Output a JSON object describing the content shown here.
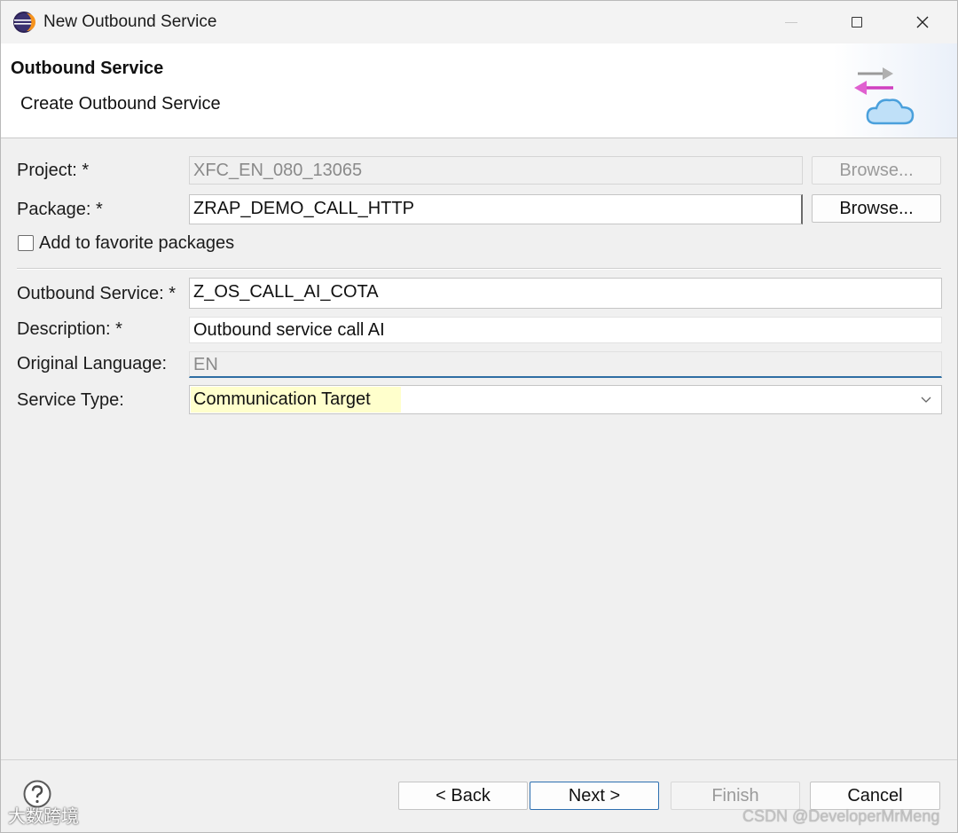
{
  "window": {
    "title": "New Outbound Service"
  },
  "banner": {
    "title": "Outbound Service",
    "subtitle": "Create Outbound Service",
    "icon": "outbound-service-cloud-icon"
  },
  "form": {
    "project": {
      "label": "Project: *",
      "value": "XFC_EN_080_13065",
      "browse_label": "Browse..."
    },
    "package": {
      "label": "Package: *",
      "value": "ZRAP_DEMO_CALL_HTTP",
      "browse_label": "Browse..."
    },
    "favorite": {
      "label": "Add to favorite packages",
      "checked": false
    },
    "outbound_service": {
      "label": "Outbound Service: *",
      "value": "Z_OS_CALL_AI_COTA"
    },
    "description": {
      "label": "Description: *",
      "value": "Outbound service call AI"
    },
    "original_language": {
      "label": "Original Language:",
      "value": "EN"
    },
    "service_type": {
      "label": "Service Type:",
      "value": "Communication Target"
    }
  },
  "footer": {
    "help_icon": "help-icon",
    "back_label": "< Back",
    "next_label": "Next >",
    "finish_label": "Finish",
    "cancel_label": "Cancel"
  },
  "watermarks": {
    "left": "大数跨境",
    "right": "CSDN @DeveloperMrMeng"
  },
  "colors": {
    "accent": "#2d6fb0",
    "highlight": "#ffffcc"
  }
}
